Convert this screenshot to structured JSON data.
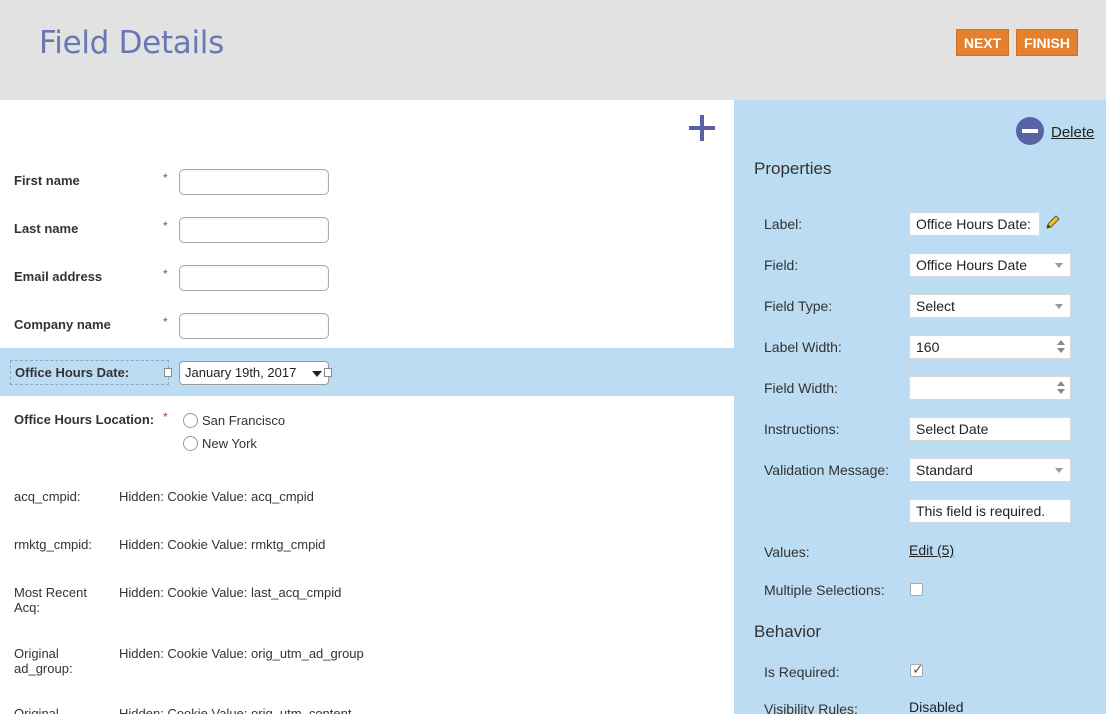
{
  "header": {
    "title": "Field Details",
    "next_label": "NEXT",
    "finish_label": "FINISH"
  },
  "form": {
    "fields": [
      {
        "label": "First name",
        "required": "*"
      },
      {
        "label": "Last name",
        "required": "*"
      },
      {
        "label": "Email address",
        "required": "*"
      },
      {
        "label": "Company name",
        "required": "*"
      }
    ],
    "selected_field": {
      "label": "Office Hours Date:",
      "value": "January 19th, 2017"
    },
    "location": {
      "label": "Office Hours Location:",
      "required": "*",
      "options": [
        "San Francisco",
        "New York"
      ]
    },
    "hidden_fields": [
      {
        "label": "acq_cmpid:",
        "value": "Hidden: Cookie Value: acq_cmpid"
      },
      {
        "label": "rmktg_cmpid:",
        "value": "Hidden: Cookie Value: rmktg_cmpid"
      },
      {
        "label": "Most Recent Acq:",
        "value": "Hidden: Cookie Value: last_acq_cmpid"
      },
      {
        "label": "Original ad_group:",
        "value": "Hidden: Cookie Value: orig_utm_ad_group"
      },
      {
        "label": "Original",
        "value": "Hidden: Cookie Value: orig_utm_content"
      }
    ]
  },
  "panel": {
    "delete_label": "Delete",
    "properties_title": "Properties",
    "label_label": "Label:",
    "label_value": "Office Hours Date:",
    "field_label": "Field:",
    "field_value": "Office Hours Date",
    "field_type_label": "Field Type:",
    "field_type_value": "Select",
    "label_width_label": "Label Width:",
    "label_width_value": "160",
    "field_width_label": "Field Width:",
    "field_width_value": "",
    "instructions_label": "Instructions:",
    "instructions_value": "Select Date",
    "validation_label": "Validation Message:",
    "validation_value": "Standard",
    "validation_text": "This field is required.",
    "values_label": "Values:",
    "values_link": "Edit (5)",
    "multiple_label": "Multiple Selections:",
    "multiple_checked": false,
    "behavior_title": "Behavior",
    "required_label": "Is Required:",
    "required_checked": true,
    "visibility_label": "Visibility Rules:",
    "visibility_value": "Disabled"
  },
  "colors": {
    "accent_orange": "#e5802e",
    "panel_blue": "#bbdcf2",
    "title_purple": "#6a77b5",
    "icon_purple": "#5a62a6"
  },
  "icons": [
    "plus-icon",
    "delete-icon",
    "pencil-icon",
    "checkmark-icon",
    "chevron-down-icon"
  ]
}
